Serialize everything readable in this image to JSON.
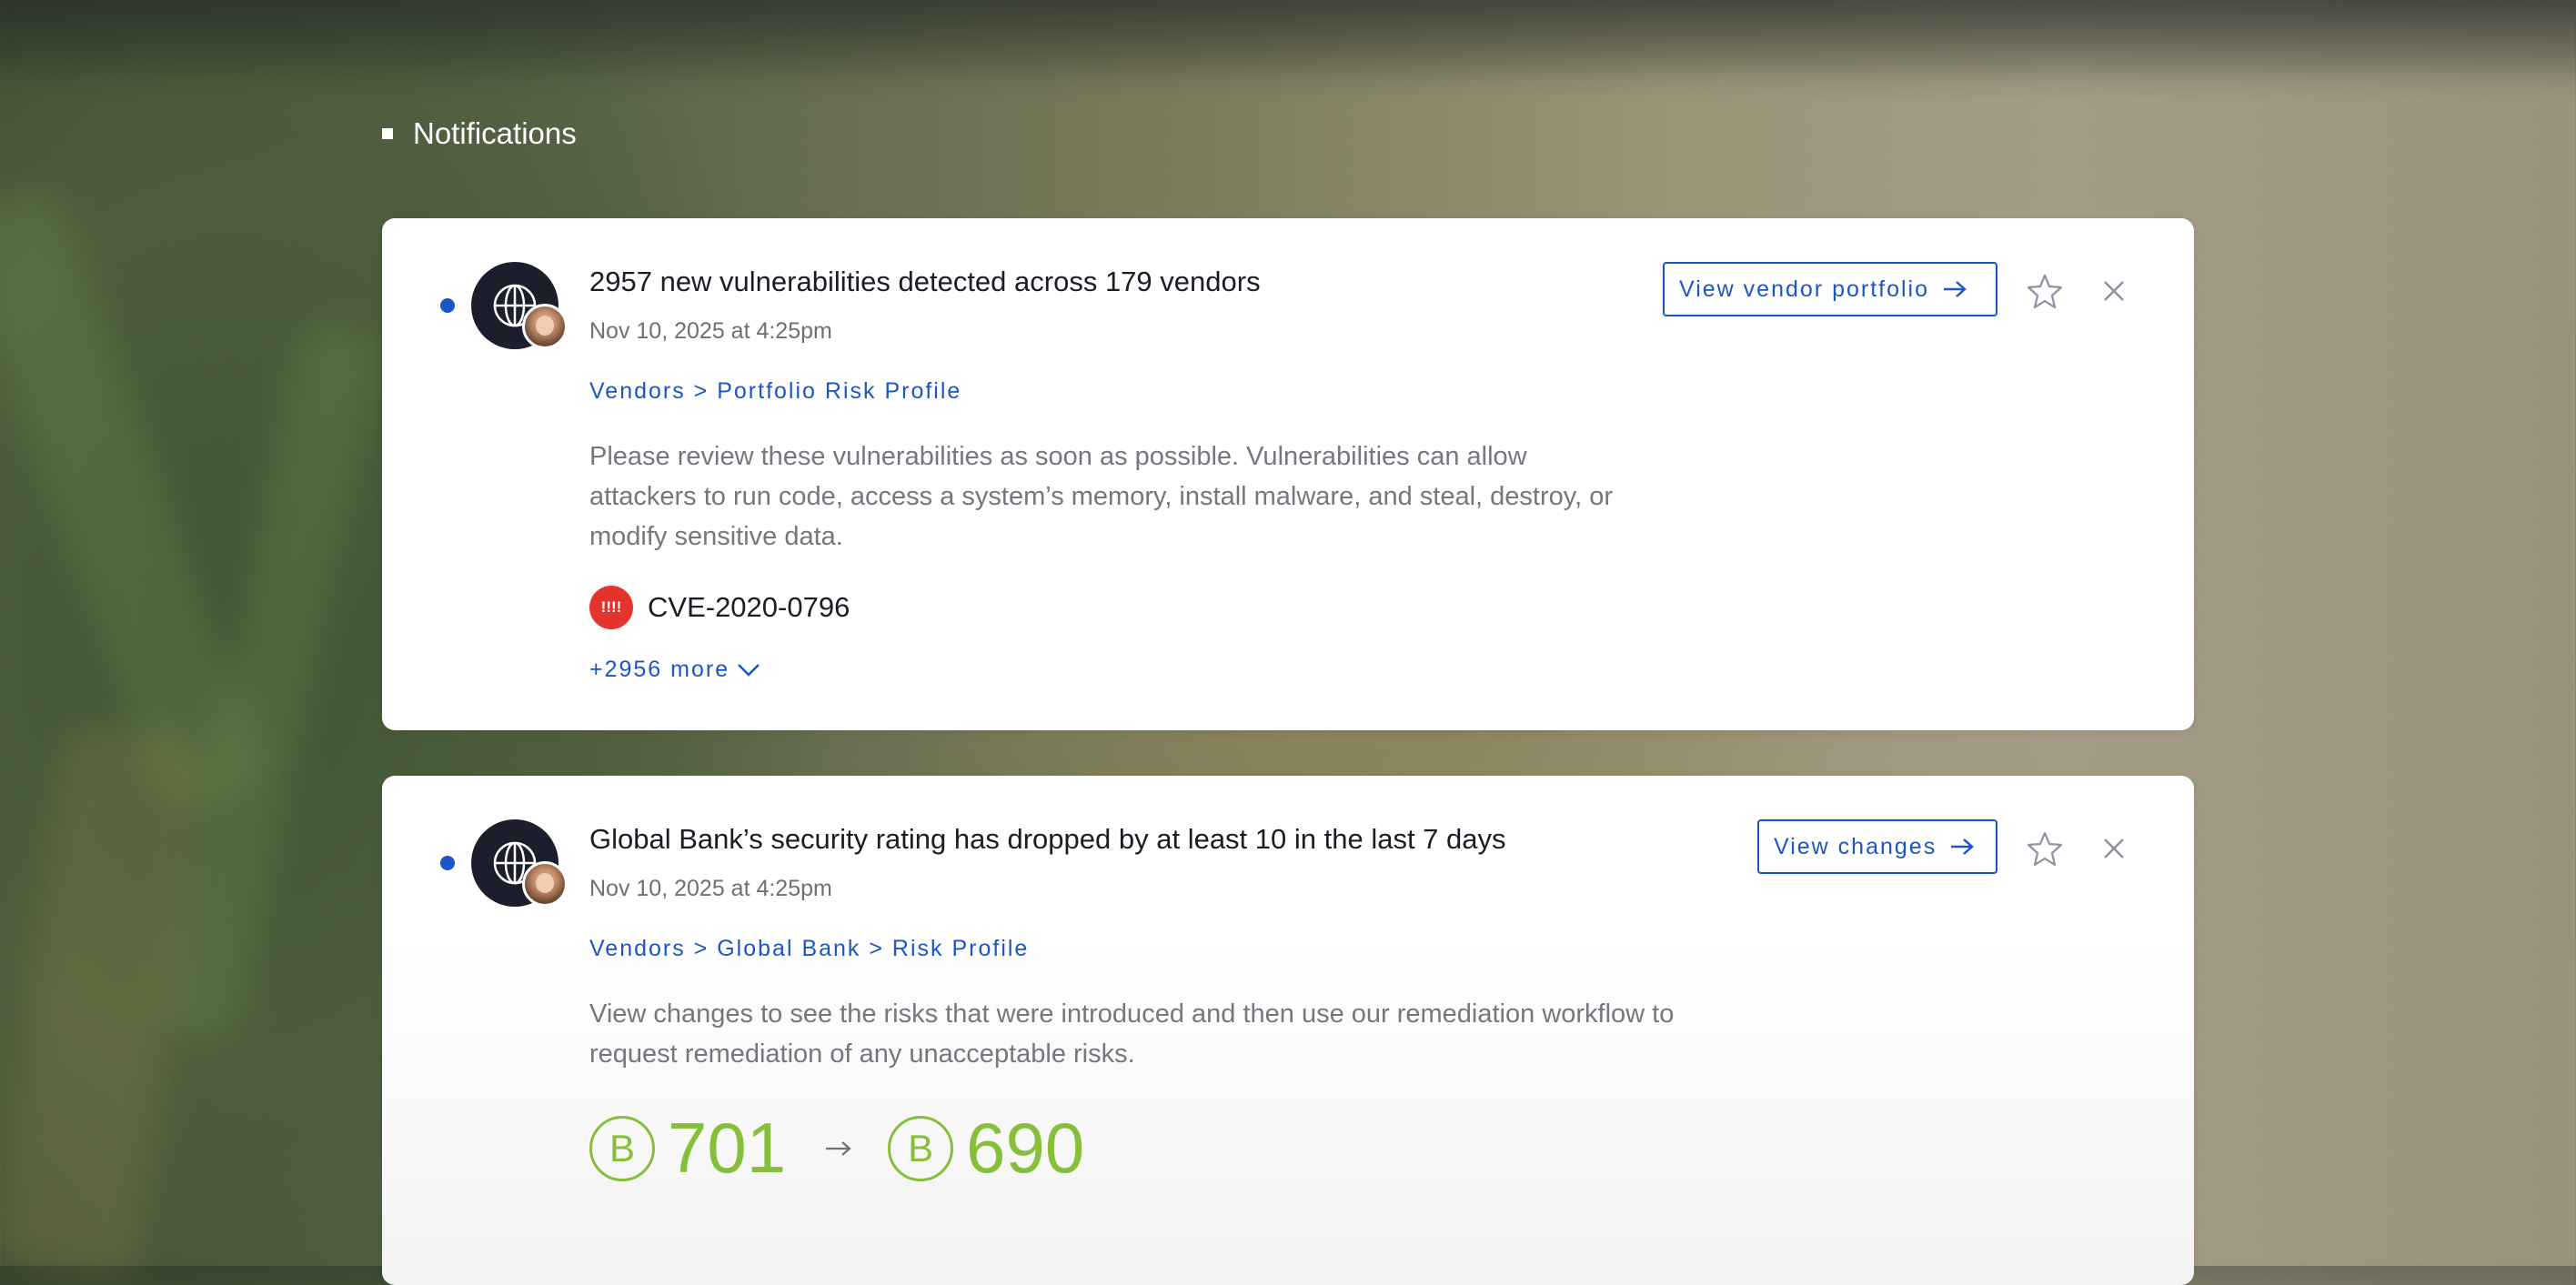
{
  "page": {
    "title": "Notifications"
  },
  "notifications": [
    {
      "title": "2957 new vulnerabilities detected across 179 vendors",
      "timestamp": "Nov 10, 2025 at 4:25pm",
      "breadcrumb": "Vendors > Portfolio Risk Profile",
      "description": "Please review these vulnerabilities as soon as possible. Vulnerabilities can allow attackers to run code, access a system’s memory, install malware, and steal, destroy, or modify sensitive data.",
      "action_label": "View vendor portfolio",
      "cve": {
        "badge": "!!!!",
        "id": "CVE-2020-0796"
      },
      "more_label": "+2956 more",
      "unread": true
    },
    {
      "title": "Global Bank’s security rating has dropped by at least 10 in the last 7 days",
      "timestamp": "Nov 10, 2025 at 4:25pm",
      "breadcrumb": "Vendors > Global Bank > Risk Profile",
      "description": "View changes to see the risks that were introduced and then use our remediation workflow to request remediation of any unacceptable risks.",
      "action_label": "View changes",
      "score_change": {
        "from_grade": "B",
        "from_score": "701",
        "to_grade": "B",
        "to_score": "690"
      },
      "unread": true
    }
  ],
  "colors": {
    "accent": "#1b56c9",
    "text_primary": "#1b1d24",
    "text_muted": "#6e7077",
    "cve_critical": "#e3332c",
    "grade_good": "#86c03a"
  },
  "icons": {
    "avatar": "globe-icon",
    "secondary_avatar": "user-photo",
    "star": "star-outline-icon",
    "close": "close-icon",
    "arrow": "arrow-right-icon",
    "more": "chevron-down-icon"
  }
}
